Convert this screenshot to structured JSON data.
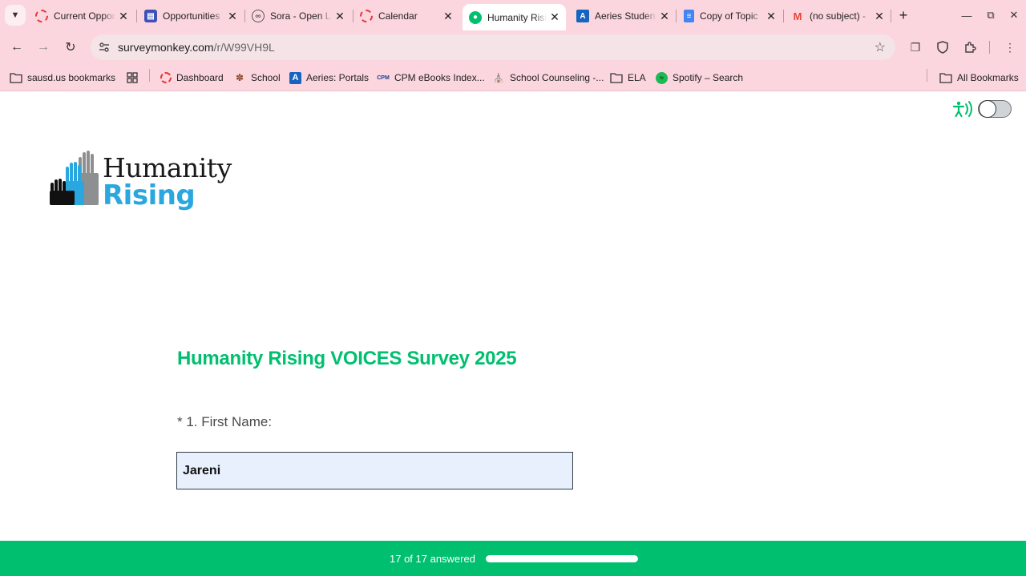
{
  "browser": {
    "tabs": [
      {
        "title": "Current Opportunities",
        "favicon": "red-ring-icon",
        "color": "#e53935",
        "active": false
      },
      {
        "title": "Opportunities",
        "favicon": "forms-icon",
        "color": "#3f51b5",
        "active": false
      },
      {
        "title": "Sora - Open Library",
        "favicon": "sora-icon",
        "color": "#7b7b9b",
        "active": false
      },
      {
        "title": "Calendar",
        "favicon": "red-ring-icon",
        "color": "#e53935",
        "active": false
      },
      {
        "title": "Humanity Rising",
        "favicon": "surveymonkey-icon",
        "color": "#00bf6f",
        "active": true
      },
      {
        "title": "Aeries Student",
        "favicon": "aeries-icon",
        "color": "#1565c0",
        "active": false
      },
      {
        "title": "Copy of Topic",
        "favicon": "docs-icon",
        "color": "#4285f4",
        "active": false
      },
      {
        "title": "(no subject) -",
        "favicon": "gmail-icon",
        "color": "#ea4335",
        "active": false
      }
    ],
    "new_tab_label": "+",
    "address": {
      "host": "surveymonkey.com",
      "path": "/r/W99VH9L"
    },
    "bookmarks": [
      {
        "label": "sausd.us bookmarks",
        "icon": "folder-icon"
      },
      {
        "label": "",
        "icon": "apps-grid-icon"
      },
      {
        "label": "Dashboard",
        "icon": "red-ring-icon"
      },
      {
        "label": "School",
        "icon": "school-icon"
      },
      {
        "label": "Aeries: Portals",
        "icon": "aeries-icon"
      },
      {
        "label": "CPM eBooks Index...",
        "icon": "cpm-icon"
      },
      {
        "label": "School Counseling -...",
        "icon": "school-building-icon"
      },
      {
        "label": "ELA",
        "icon": "folder-icon"
      },
      {
        "label": "Spotify – Search",
        "icon": "spotify-icon"
      }
    ],
    "all_bookmarks_label": "All Bookmarks"
  },
  "page": {
    "logo": {
      "line1": "Humanity",
      "line2": "Rising"
    },
    "survey_title": "Humanity Rising VOICES Survey 2025",
    "question": {
      "label": "* 1. First Name:",
      "value": "Jareni"
    },
    "footer": {
      "progress_text": "17 of 17 answered",
      "progress_fraction": 1.0
    },
    "colors": {
      "accent": "#00bf6f",
      "logo_blue": "#2aa7df",
      "input_bg": "#e8f0fe"
    }
  }
}
